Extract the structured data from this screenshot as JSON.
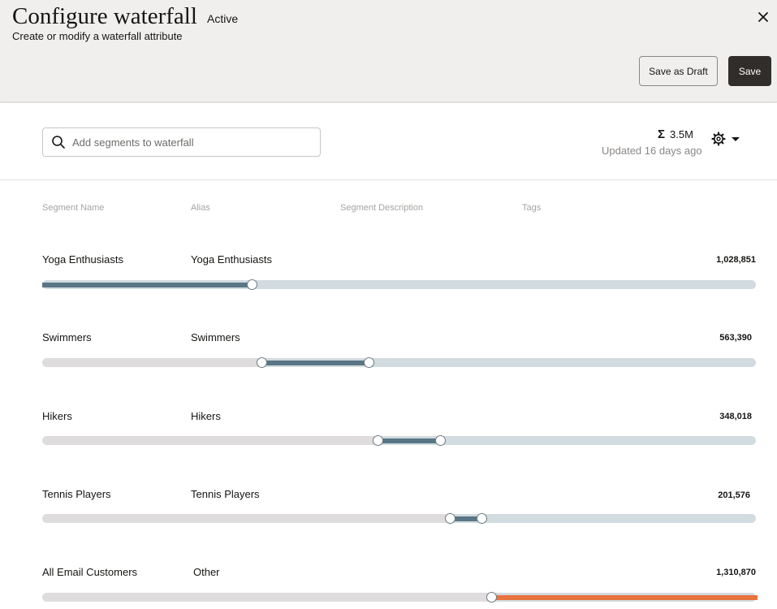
{
  "header": {
    "title": "Configure waterfall",
    "status": "Active",
    "subtitle": "Create or modify a waterfall attribute",
    "save_draft_label": "Save as Draft",
    "save_label": "Save"
  },
  "toolbar": {
    "search_placeholder": "Add segments to waterfall",
    "total": "3.5M",
    "updated": "Updated 16 days ago"
  },
  "columns": {
    "segment_name": "Segment Name",
    "alias": "Alias",
    "description": "Segment Description",
    "tags": "Tags"
  },
  "segments": [
    {
      "name": "Yoga Enthusiasts",
      "alias": "Yoga Enthusiasts",
      "count": "1,028,851",
      "range": [
        0,
        0.293
      ]
    },
    {
      "name": "Swimmers",
      "alias": "Swimmers",
      "count": "563,390",
      "range": [
        0.307,
        0.457
      ]
    },
    {
      "name": "Hikers",
      "alias": "Hikers",
      "count": "348,018",
      "range": [
        0.47,
        0.557
      ]
    },
    {
      "name": "Tennis Players",
      "alias": "Tennis Players",
      "count": "201,576",
      "range": [
        0.571,
        0.616
      ]
    },
    {
      "name": "All Email Customers",
      "alias": "Other",
      "count": "1,310,870",
      "range": [
        0.629,
        1.0
      ]
    }
  ],
  "colors": {
    "accent": "#597686",
    "remainder": "#e9733e",
    "save_button": "#312d2a"
  }
}
